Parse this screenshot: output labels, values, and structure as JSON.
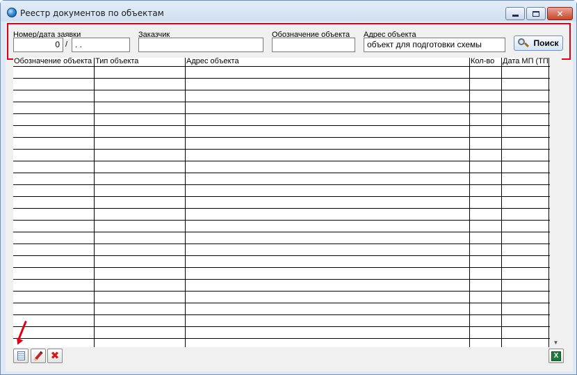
{
  "window": {
    "title": "Реестр документов по объектам",
    "close_glyph": "✕"
  },
  "filters": {
    "request_label": "Номер/дата заявки",
    "request_number": "0",
    "separator": "/",
    "request_date": " .  .",
    "customer_label": "Заказчик",
    "customer_value": "",
    "designation_label": "Обозначение объекта",
    "designation_value": "",
    "address_label": "Адрес объекта",
    "address_value": "объект для подготовки схемы",
    "search_label": "Поиск"
  },
  "table": {
    "columns": [
      "Обозначение объекта",
      "Тип объекта",
      "Адрес объекта",
      "Кол-во",
      "Дата МП (ТП)"
    ],
    "row_count": 23
  },
  "toolbar": {
    "excel_glyph": "X",
    "delete_glyph": "✖"
  },
  "colors": {
    "highlight": "#e0001a",
    "window_border": "#6f8fb8"
  }
}
